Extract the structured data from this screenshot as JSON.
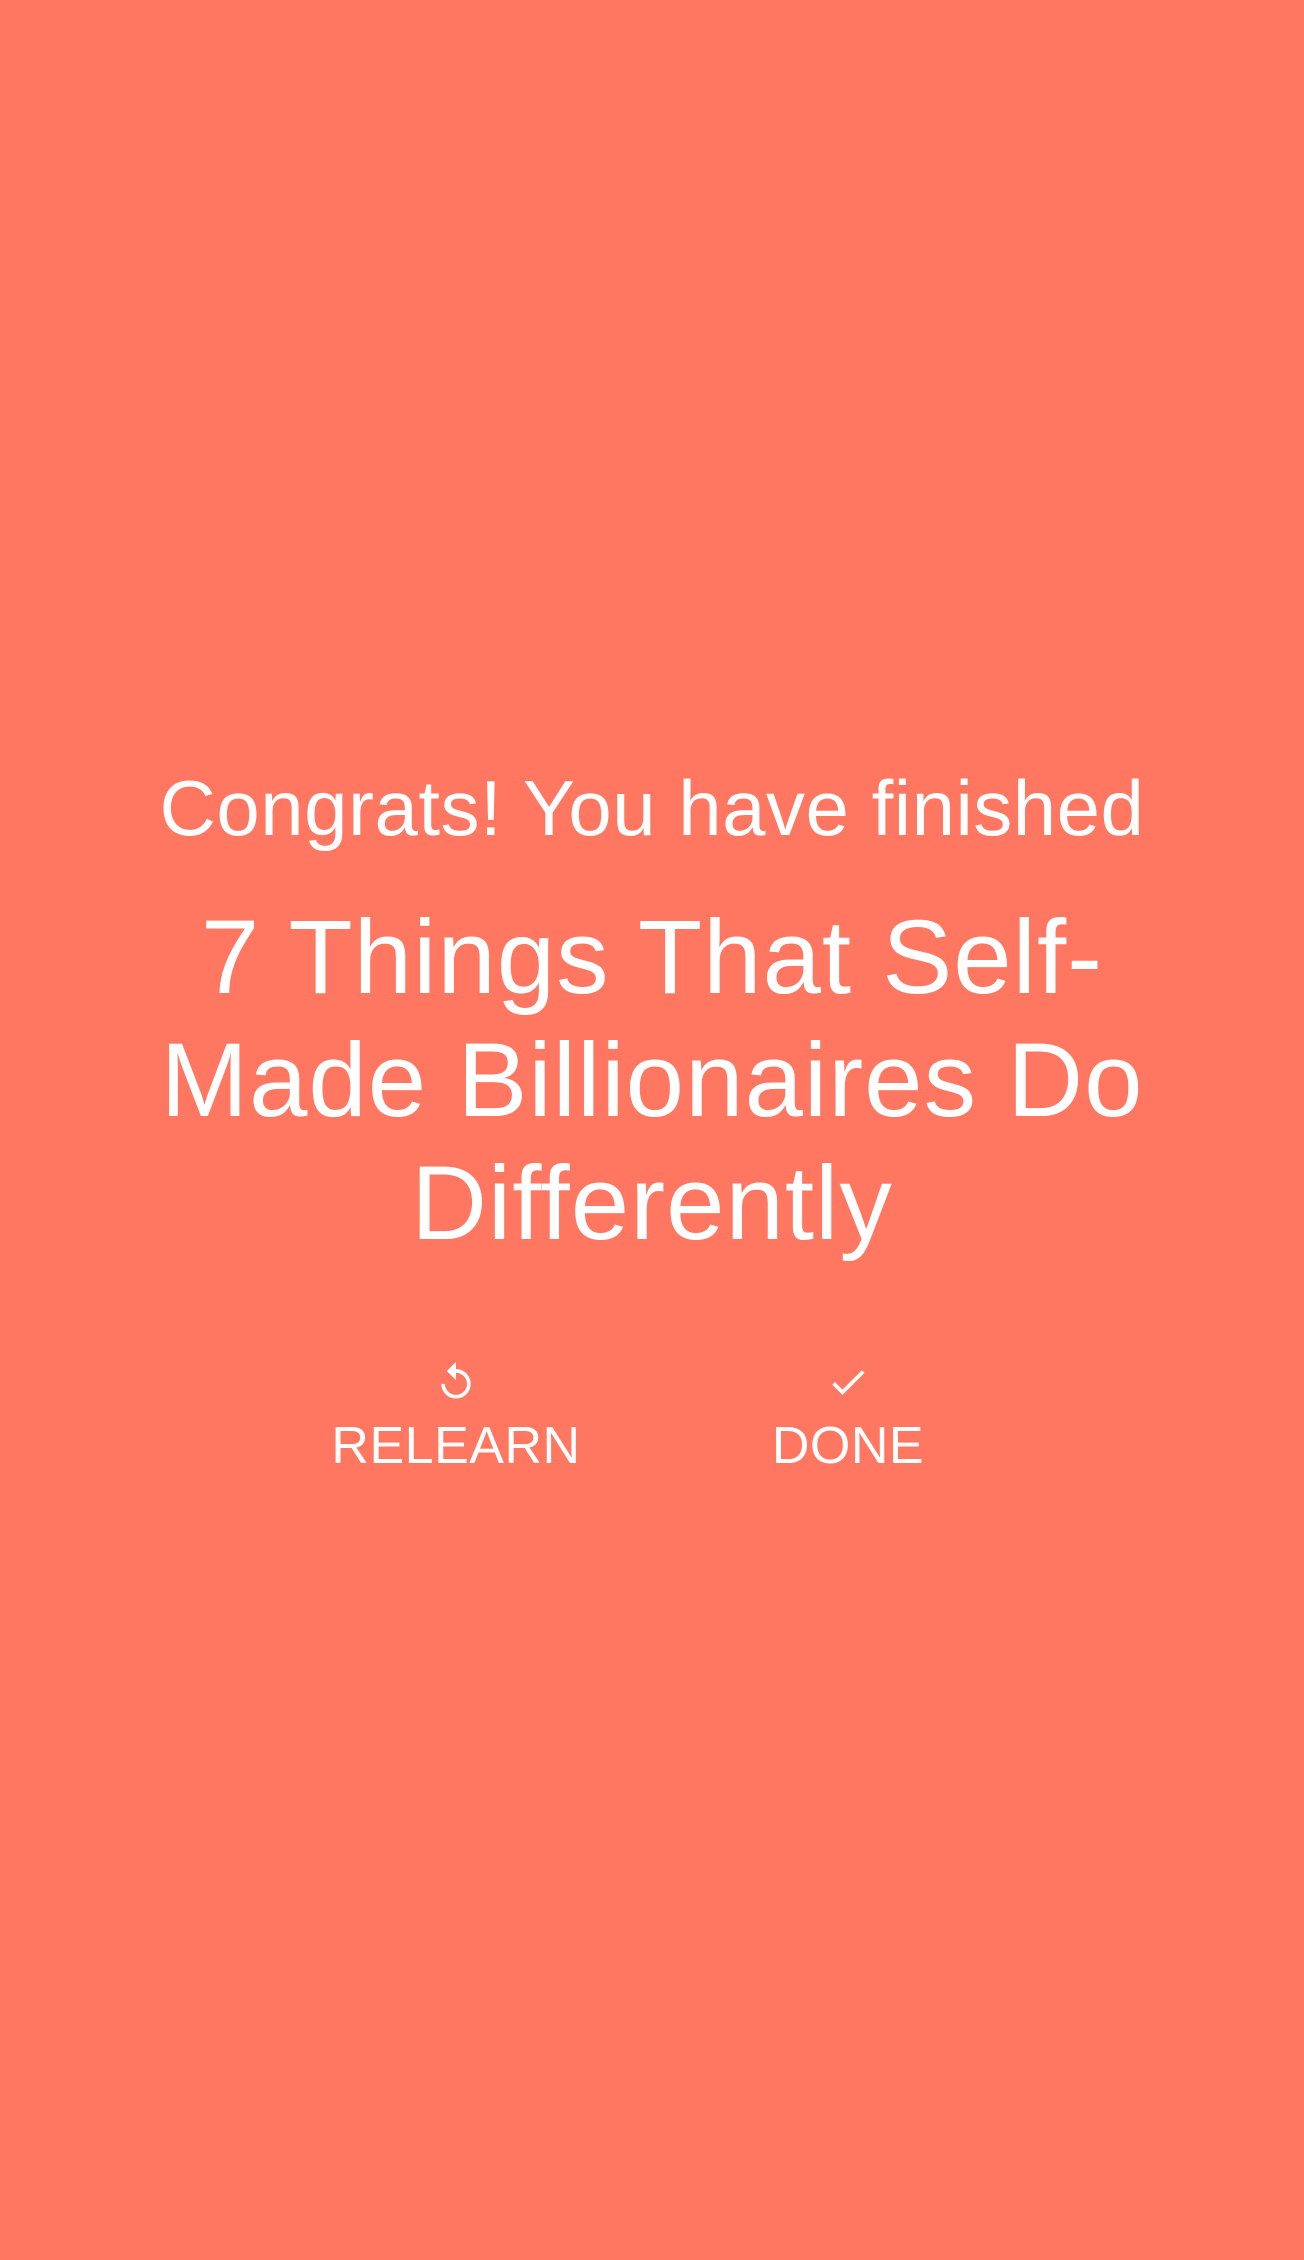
{
  "theme": {
    "background_color": "#FF7661",
    "text_color": "#FFFFFF"
  },
  "completion": {
    "congrats_text": "Congrats! You have finished",
    "book_title": "7 Things That Self-Made Billionaires Do Differently"
  },
  "actions": {
    "relearn": {
      "label": "RELEARN",
      "icon": "replay-icon"
    },
    "done": {
      "label": "DONE",
      "icon": "check-icon"
    }
  }
}
